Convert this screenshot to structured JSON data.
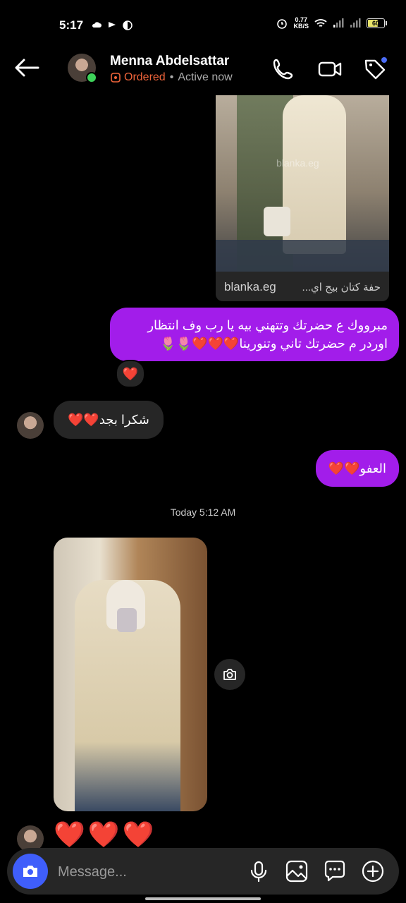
{
  "status_bar": {
    "time": "5:17",
    "network_speed": "0.77\nKB/S",
    "battery": "60"
  },
  "header": {
    "contact_name": "Menna Abdelsattar",
    "badge": "Ordered",
    "separator": "•",
    "active_status": "Active now"
  },
  "messages": {
    "shared_post": {
      "domain": "blanka.eg",
      "description": "حفة كتان بيج اي...",
      "watermark": "blanka.eg"
    },
    "outgoing_1": "مبرووك ع حضرتك وتتهني بيه يا رب وف انتظار اوردر م حضرتك تاني وتنورينا❤️❤️❤️🌷🌷",
    "reaction_1": "❤️",
    "incoming_1": "شكرا بجد❤️❤️",
    "outgoing_2": "العفو❤️❤️",
    "timestamp": "Today 5:12 AM",
    "incoming_hearts": "❤️❤️❤️"
  },
  "composer": {
    "placeholder": "Message..."
  },
  "colors": {
    "outgoing_bubble": "#a21dea",
    "incoming_bubble": "#262626",
    "camera_button": "#3f5efb",
    "ordered": "#f0643a",
    "online": "#3ed25a"
  },
  "icons": {
    "back": "back-arrow-icon",
    "call": "phone-icon",
    "video": "video-camera-icon",
    "tag": "tag-icon",
    "camera": "camera-icon",
    "mic": "microphone-icon",
    "gallery": "gallery-icon",
    "sticker": "chat-bubble-icon",
    "add": "plus-circle-icon"
  }
}
